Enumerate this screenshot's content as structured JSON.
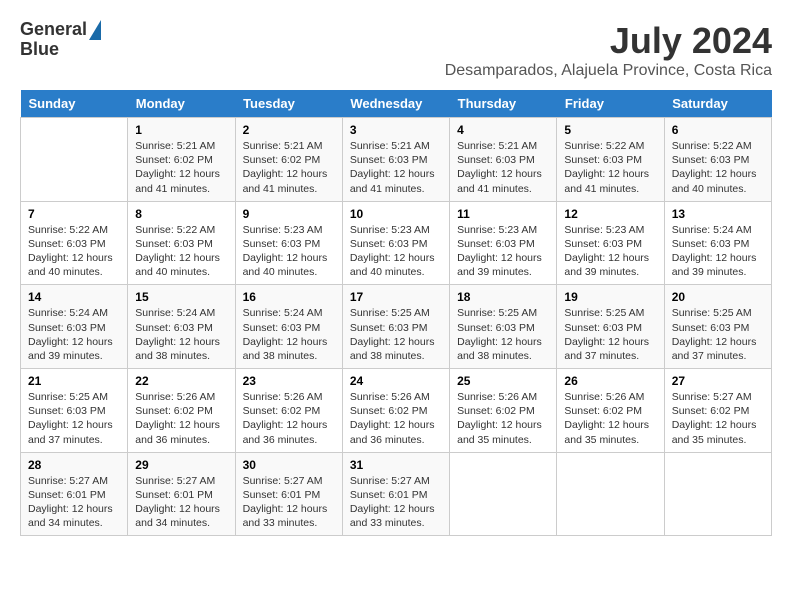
{
  "header": {
    "logo_line1": "General",
    "logo_line2": "Blue",
    "title": "July 2024",
    "subtitle": "Desamparados, Alajuela Province, Costa Rica"
  },
  "columns": [
    "Sunday",
    "Monday",
    "Tuesday",
    "Wednesday",
    "Thursday",
    "Friday",
    "Saturday"
  ],
  "weeks": [
    [
      {
        "day": "",
        "sunrise": "",
        "sunset": "",
        "daylight": ""
      },
      {
        "day": "1",
        "sunrise": "Sunrise: 5:21 AM",
        "sunset": "Sunset: 6:02 PM",
        "daylight": "Daylight: 12 hours and 41 minutes."
      },
      {
        "day": "2",
        "sunrise": "Sunrise: 5:21 AM",
        "sunset": "Sunset: 6:02 PM",
        "daylight": "Daylight: 12 hours and 41 minutes."
      },
      {
        "day": "3",
        "sunrise": "Sunrise: 5:21 AM",
        "sunset": "Sunset: 6:03 PM",
        "daylight": "Daylight: 12 hours and 41 minutes."
      },
      {
        "day": "4",
        "sunrise": "Sunrise: 5:21 AM",
        "sunset": "Sunset: 6:03 PM",
        "daylight": "Daylight: 12 hours and 41 minutes."
      },
      {
        "day": "5",
        "sunrise": "Sunrise: 5:22 AM",
        "sunset": "Sunset: 6:03 PM",
        "daylight": "Daylight: 12 hours and 41 minutes."
      },
      {
        "day": "6",
        "sunrise": "Sunrise: 5:22 AM",
        "sunset": "Sunset: 6:03 PM",
        "daylight": "Daylight: 12 hours and 40 minutes."
      }
    ],
    [
      {
        "day": "7",
        "sunrise": "Sunrise: 5:22 AM",
        "sunset": "Sunset: 6:03 PM",
        "daylight": "Daylight: 12 hours and 40 minutes."
      },
      {
        "day": "8",
        "sunrise": "Sunrise: 5:22 AM",
        "sunset": "Sunset: 6:03 PM",
        "daylight": "Daylight: 12 hours and 40 minutes."
      },
      {
        "day": "9",
        "sunrise": "Sunrise: 5:23 AM",
        "sunset": "Sunset: 6:03 PM",
        "daylight": "Daylight: 12 hours and 40 minutes."
      },
      {
        "day": "10",
        "sunrise": "Sunrise: 5:23 AM",
        "sunset": "Sunset: 6:03 PM",
        "daylight": "Daylight: 12 hours and 40 minutes."
      },
      {
        "day": "11",
        "sunrise": "Sunrise: 5:23 AM",
        "sunset": "Sunset: 6:03 PM",
        "daylight": "Daylight: 12 hours and 39 minutes."
      },
      {
        "day": "12",
        "sunrise": "Sunrise: 5:23 AM",
        "sunset": "Sunset: 6:03 PM",
        "daylight": "Daylight: 12 hours and 39 minutes."
      },
      {
        "day": "13",
        "sunrise": "Sunrise: 5:24 AM",
        "sunset": "Sunset: 6:03 PM",
        "daylight": "Daylight: 12 hours and 39 minutes."
      }
    ],
    [
      {
        "day": "14",
        "sunrise": "Sunrise: 5:24 AM",
        "sunset": "Sunset: 6:03 PM",
        "daylight": "Daylight: 12 hours and 39 minutes."
      },
      {
        "day": "15",
        "sunrise": "Sunrise: 5:24 AM",
        "sunset": "Sunset: 6:03 PM",
        "daylight": "Daylight: 12 hours and 38 minutes."
      },
      {
        "day": "16",
        "sunrise": "Sunrise: 5:24 AM",
        "sunset": "Sunset: 6:03 PM",
        "daylight": "Daylight: 12 hours and 38 minutes."
      },
      {
        "day": "17",
        "sunrise": "Sunrise: 5:25 AM",
        "sunset": "Sunset: 6:03 PM",
        "daylight": "Daylight: 12 hours and 38 minutes."
      },
      {
        "day": "18",
        "sunrise": "Sunrise: 5:25 AM",
        "sunset": "Sunset: 6:03 PM",
        "daylight": "Daylight: 12 hours and 38 minutes."
      },
      {
        "day": "19",
        "sunrise": "Sunrise: 5:25 AM",
        "sunset": "Sunset: 6:03 PM",
        "daylight": "Daylight: 12 hours and 37 minutes."
      },
      {
        "day": "20",
        "sunrise": "Sunrise: 5:25 AM",
        "sunset": "Sunset: 6:03 PM",
        "daylight": "Daylight: 12 hours and 37 minutes."
      }
    ],
    [
      {
        "day": "21",
        "sunrise": "Sunrise: 5:25 AM",
        "sunset": "Sunset: 6:03 PM",
        "daylight": "Daylight: 12 hours and 37 minutes."
      },
      {
        "day": "22",
        "sunrise": "Sunrise: 5:26 AM",
        "sunset": "Sunset: 6:02 PM",
        "daylight": "Daylight: 12 hours and 36 minutes."
      },
      {
        "day": "23",
        "sunrise": "Sunrise: 5:26 AM",
        "sunset": "Sunset: 6:02 PM",
        "daylight": "Daylight: 12 hours and 36 minutes."
      },
      {
        "day": "24",
        "sunrise": "Sunrise: 5:26 AM",
        "sunset": "Sunset: 6:02 PM",
        "daylight": "Daylight: 12 hours and 36 minutes."
      },
      {
        "day": "25",
        "sunrise": "Sunrise: 5:26 AM",
        "sunset": "Sunset: 6:02 PM",
        "daylight": "Daylight: 12 hours and 35 minutes."
      },
      {
        "day": "26",
        "sunrise": "Sunrise: 5:26 AM",
        "sunset": "Sunset: 6:02 PM",
        "daylight": "Daylight: 12 hours and 35 minutes."
      },
      {
        "day": "27",
        "sunrise": "Sunrise: 5:27 AM",
        "sunset": "Sunset: 6:02 PM",
        "daylight": "Daylight: 12 hours and 35 minutes."
      }
    ],
    [
      {
        "day": "28",
        "sunrise": "Sunrise: 5:27 AM",
        "sunset": "Sunset: 6:01 PM",
        "daylight": "Daylight: 12 hours and 34 minutes."
      },
      {
        "day": "29",
        "sunrise": "Sunrise: 5:27 AM",
        "sunset": "Sunset: 6:01 PM",
        "daylight": "Daylight: 12 hours and 34 minutes."
      },
      {
        "day": "30",
        "sunrise": "Sunrise: 5:27 AM",
        "sunset": "Sunset: 6:01 PM",
        "daylight": "Daylight: 12 hours and 33 minutes."
      },
      {
        "day": "31",
        "sunrise": "Sunrise: 5:27 AM",
        "sunset": "Sunset: 6:01 PM",
        "daylight": "Daylight: 12 hours and 33 minutes."
      },
      {
        "day": "",
        "sunrise": "",
        "sunset": "",
        "daylight": ""
      },
      {
        "day": "",
        "sunrise": "",
        "sunset": "",
        "daylight": ""
      },
      {
        "day": "",
        "sunrise": "",
        "sunset": "",
        "daylight": ""
      }
    ]
  ]
}
